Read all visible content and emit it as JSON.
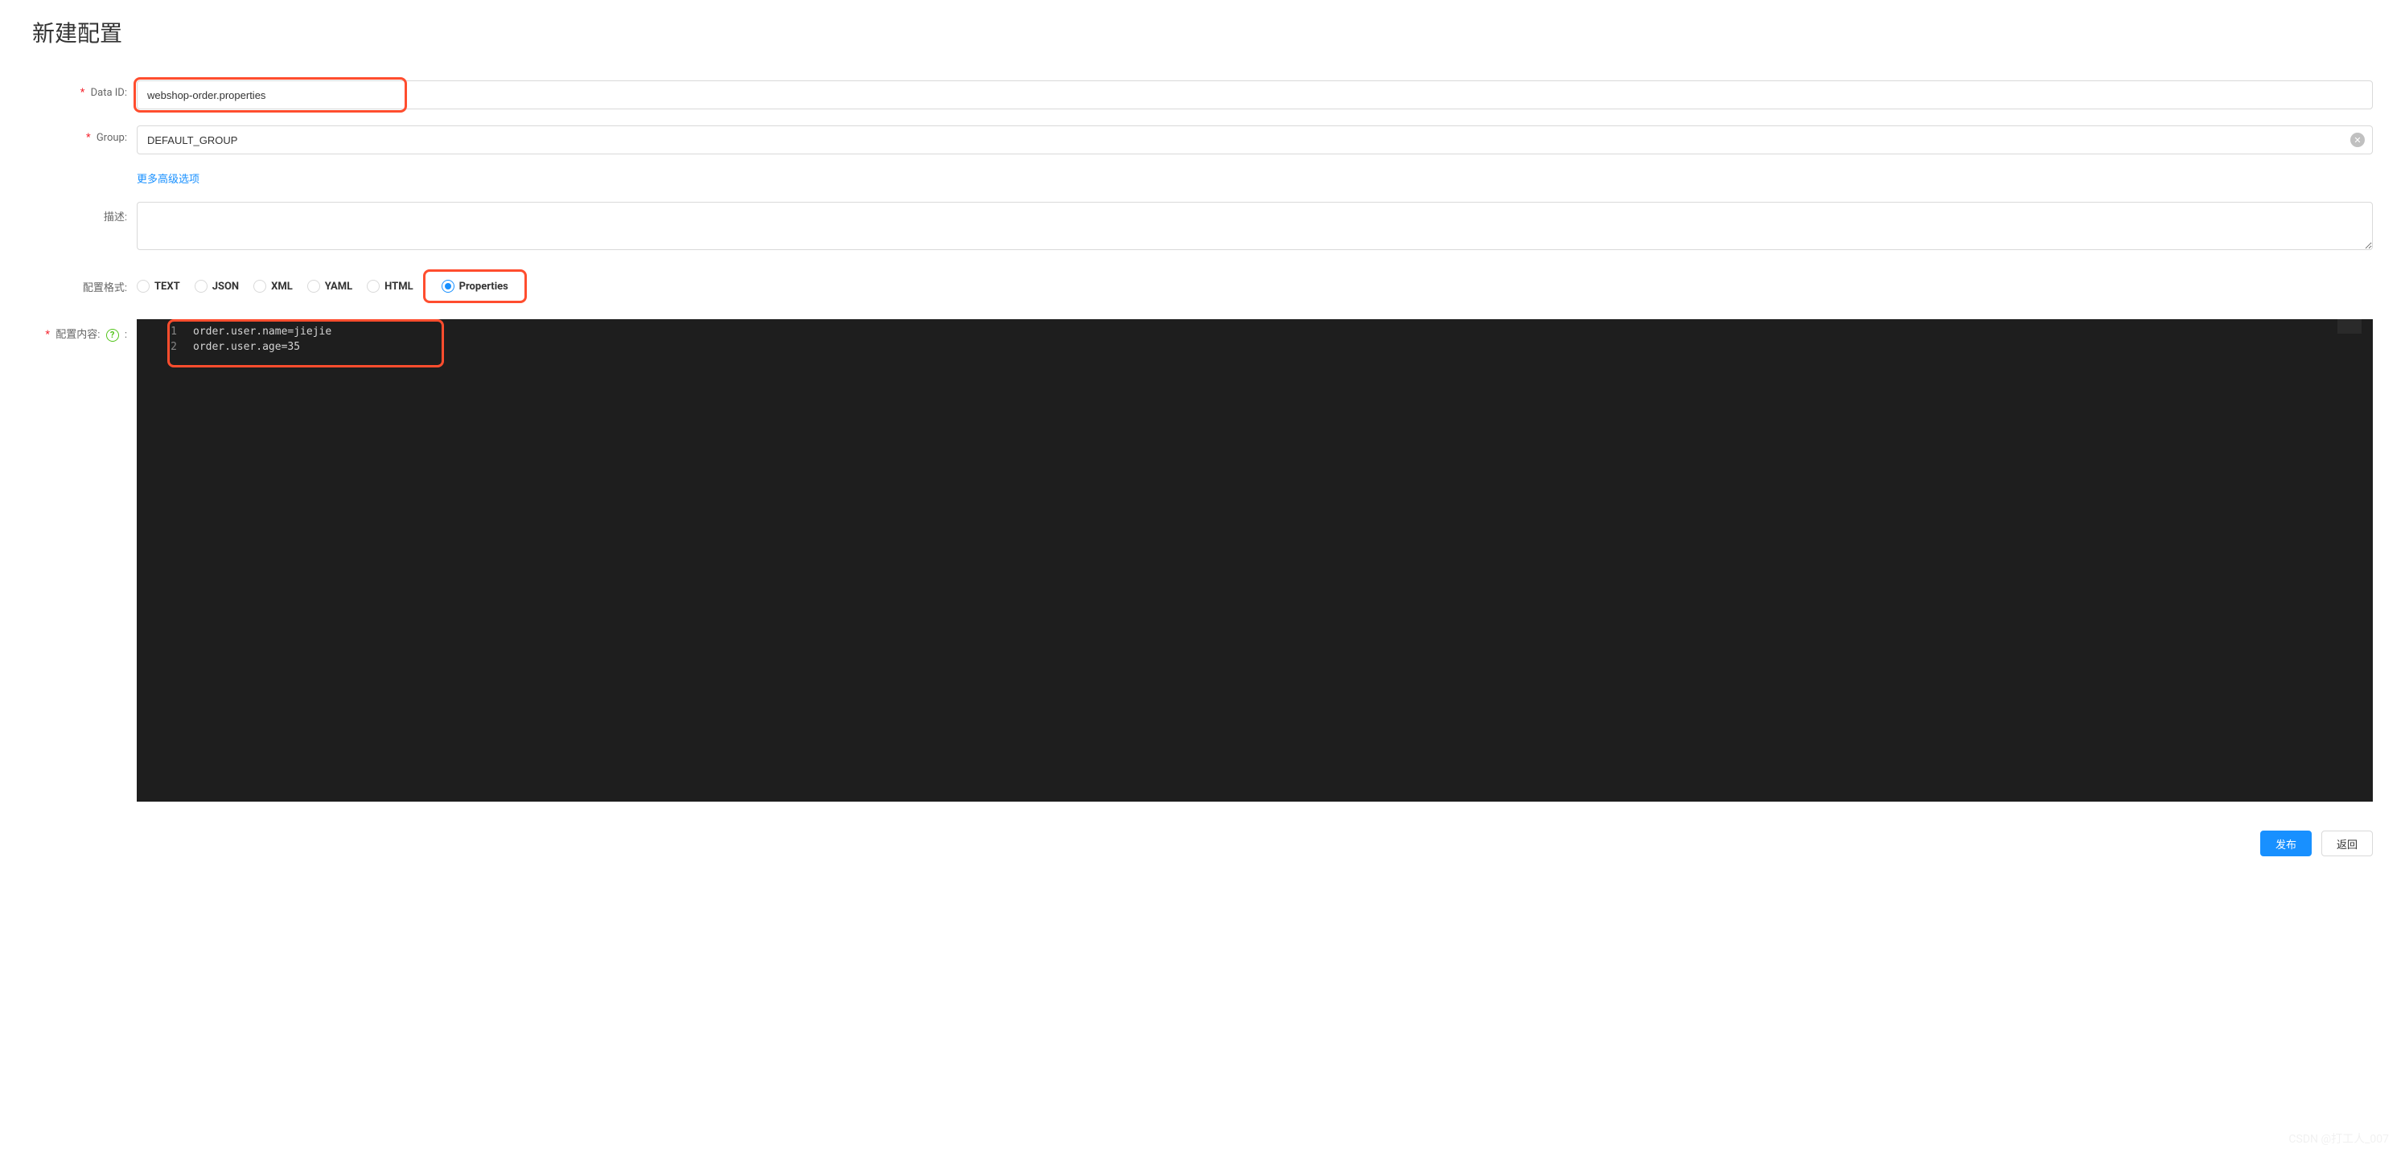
{
  "page": {
    "title": "新建配置"
  },
  "form": {
    "dataId": {
      "label": "Data ID:",
      "value": "webshop-order.properties"
    },
    "group": {
      "label": "Group:",
      "value": "DEFAULT_GROUP"
    },
    "advancedLink": "更多高级选项",
    "description": {
      "label": "描述:",
      "value": ""
    },
    "format": {
      "label": "配置格式:",
      "options": [
        "TEXT",
        "JSON",
        "XML",
        "YAML",
        "HTML",
        "Properties"
      ],
      "selected": "Properties"
    },
    "content": {
      "label": "配置内容:",
      "lines": [
        "order.user.name=jiejie",
        "order.user.age=35"
      ]
    }
  },
  "actions": {
    "publish": "发布",
    "back": "返回"
  },
  "watermark": "CSDN @打工人_007"
}
